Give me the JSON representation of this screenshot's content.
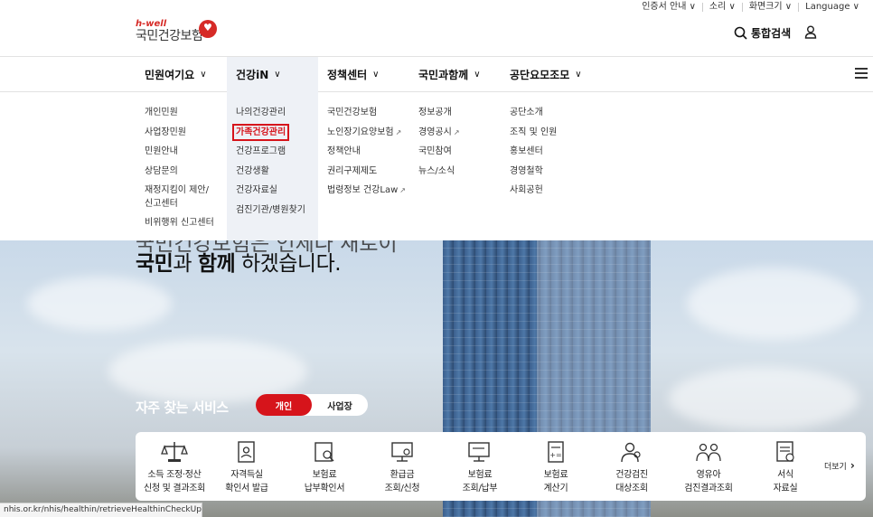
{
  "util": [
    "인증서 안내 ∨",
    "소리 ∨",
    "화면크기 ∨",
    "Language ∨"
  ],
  "logo": {
    "tag": "h-well",
    "name": "국민건강보험"
  },
  "header": {
    "search_label": "통합검색"
  },
  "gnb": [
    {
      "label": "민원여기요",
      "chev": "∨"
    },
    {
      "label": "건강iN",
      "chev": "∨"
    },
    {
      "label": "정책센터",
      "chev": "∨"
    },
    {
      "label": "국민과함께",
      "chev": "∨"
    },
    {
      "label": "공단요모조모",
      "chev": "∨"
    }
  ],
  "menu": {
    "col0": [
      "개인민원",
      "사업장민원",
      "민원안내",
      "상담문의",
      "재정지킴이 제안/신고센터",
      "비위행위 신고센터"
    ],
    "col1": [
      "나의건강관리",
      "가족건강관리",
      "건강프로그램",
      "건강생활",
      "건강자료실",
      "검진기관/병원찾기"
    ],
    "col2": [
      "국민건강보험",
      "노인장기요양보험",
      "정책안내",
      "권리구제제도",
      "법령정보 건강Law"
    ],
    "col3": [
      "정보공개",
      "경영공시",
      "국민참여",
      "뉴스/소식"
    ],
    "col4": [
      "공단소개",
      "조직 및 인원",
      "홍보센터",
      "경영철학",
      "사회공헌"
    ],
    "ext_mark": "↗"
  },
  "hero": {
    "line_top": "국민건강보험은 언제나 새로이",
    "word1": "국민",
    "mid": "과 ",
    "word2": "함께",
    "end": " 하겠습니다."
  },
  "services": {
    "title": "자주 찾는 서비스",
    "tab_on": "개인",
    "tab_off": "사업장",
    "items": [
      {
        "l1": "소득 조정·정산",
        "l2": "신청 및 결과조회"
      },
      {
        "l1": "자격득실",
        "l2": "확인서 발급"
      },
      {
        "l1": "보험료",
        "l2": "납부확인서"
      },
      {
        "l1": "환급금",
        "l2": "조회/신청"
      },
      {
        "l1": "보험료",
        "l2": "조회/납부"
      },
      {
        "l1": "보험료",
        "l2": "계산기"
      },
      {
        "l1": "건강검진",
        "l2": "대상조회"
      },
      {
        "l1": "영유아",
        "l2": "검진결과조회"
      },
      {
        "l1": "서식",
        "l2": "자료실"
      }
    ],
    "more": "더보기"
  },
  "status_url": "nhis.or.kr/nhis/healthin/retrieveHealthinCheckUpTargetinfants.do",
  "colors": {
    "accent": "#d6141b",
    "active_bg": "#eef1f6"
  }
}
